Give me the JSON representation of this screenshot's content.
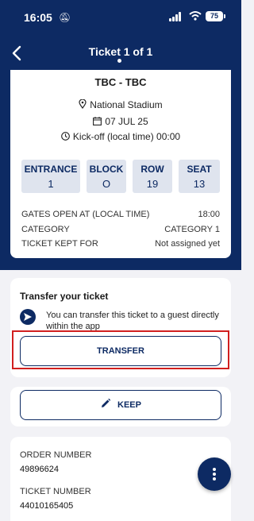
{
  "status_bar": {
    "time": "16:05",
    "battery": "75"
  },
  "header": {
    "title": "Ticket 1 of 1"
  },
  "ticket": {
    "match": "TBC - TBC",
    "venue": "National Stadium",
    "date": "07 JUL 25",
    "kickoff": "Kick-off (local time)  00:00",
    "blocks": [
      {
        "label": "ENTRANCE",
        "value": "1"
      },
      {
        "label": "BLOCK",
        "value": "O"
      },
      {
        "label": "ROW",
        "value": "19"
      },
      {
        "label": "SEAT",
        "value": "13"
      }
    ],
    "details": [
      {
        "key": "GATES OPEN AT (LOCAL TIME)",
        "value": "18:00"
      },
      {
        "key": "CATEGORY",
        "value": "CATEGORY 1"
      },
      {
        "key": "TICKET KEPT FOR",
        "value": "Not assigned yet"
      }
    ]
  },
  "transfer": {
    "title": "Transfer your ticket",
    "description": "You can transfer this ticket to a guest directly within the app",
    "button_label": "TRANSFER"
  },
  "keep": {
    "button_label": "KEEP"
  },
  "order": {
    "order_number_label": "ORDER NUMBER",
    "order_number": "49896624",
    "ticket_number_label": "TICKET NUMBER",
    "ticket_number": "44010165405"
  },
  "colors": {
    "primary": "#0d2a63",
    "highlight": "#d11f1f",
    "background": "#f2f2f6"
  }
}
